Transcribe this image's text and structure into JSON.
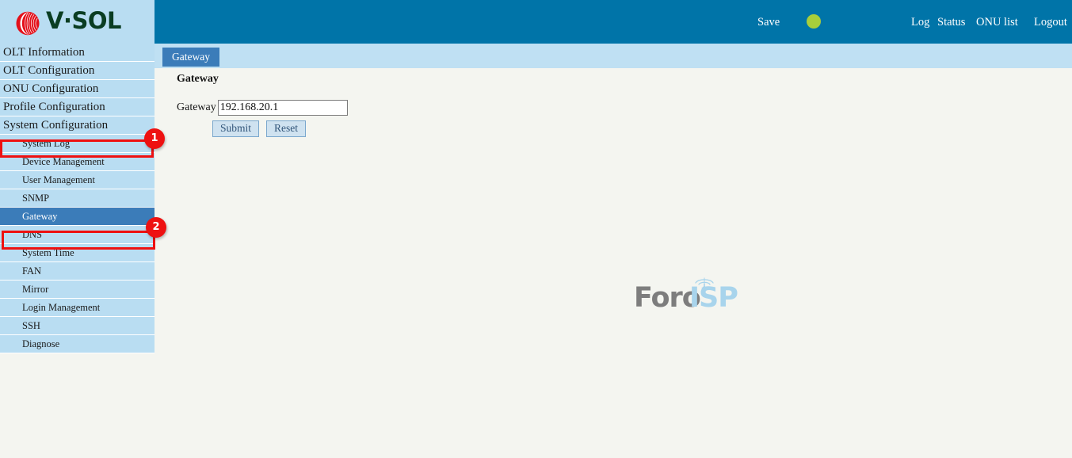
{
  "header": {
    "brand": "V·SOL",
    "brand_icon": "vsol-logo-icon",
    "save_label": "Save",
    "save_indicator_color": "#a8ce3a",
    "links": [
      {
        "label": "Log"
      },
      {
        "label": "Status"
      },
      {
        "label": "ONU list"
      },
      {
        "label": "Logout"
      }
    ],
    "background_color": "#0074a8"
  },
  "tabs": [
    {
      "label": "Gateway",
      "active": true
    }
  ],
  "sidebar": {
    "background_color": "#b9ddf2",
    "selected_color": "#3b7cb9",
    "main_items": [
      {
        "label": "OLT Information"
      },
      {
        "label": "OLT Configuration"
      },
      {
        "label": "ONU Configuration"
      },
      {
        "label": "Profile Configuration"
      },
      {
        "label": "System Configuration"
      }
    ],
    "sub_items": [
      {
        "label": "System Log"
      },
      {
        "label": "Device Management"
      },
      {
        "label": "User Management"
      },
      {
        "label": "SNMP"
      },
      {
        "label": "Gateway"
      },
      {
        "label": "DNS"
      },
      {
        "label": "System Time"
      },
      {
        "label": "FAN"
      },
      {
        "label": "Mirror"
      },
      {
        "label": "Login Management"
      },
      {
        "label": "SSH"
      },
      {
        "label": "Diagnose"
      }
    ]
  },
  "main": {
    "title": "Gateway",
    "field_label": "Gateway",
    "field_value": "192.168.20.1",
    "submit_label": "Submit",
    "reset_label": "Reset"
  },
  "watermark": {
    "text_primary": "Foro",
    "text_secondary": "ISP",
    "primary_color": "#7d7d7d",
    "secondary_color": "#a8d4ec"
  },
  "annotations": {
    "color": "#ee1111",
    "markers": [
      {
        "number": "1",
        "target": "System Configuration"
      },
      {
        "number": "2",
        "target": "Gateway"
      }
    ]
  }
}
